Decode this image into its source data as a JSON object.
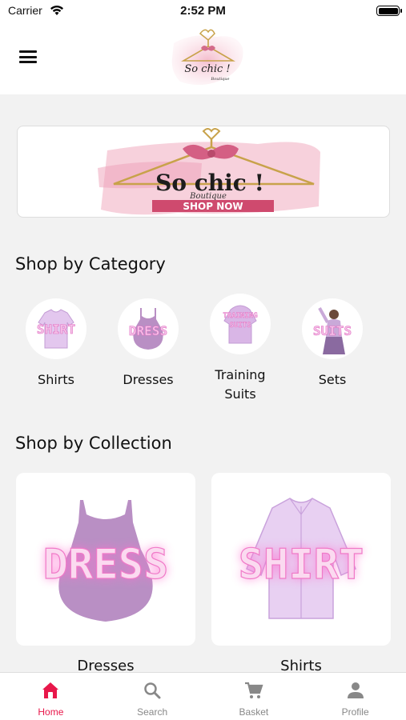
{
  "status_bar": {
    "carrier": "Carrier",
    "time": "2:52 PM"
  },
  "header": {
    "logo_text": "So chic !",
    "logo_subtext": "Boutique"
  },
  "banner": {
    "logo_text": "So chic !",
    "logo_subtext": "Boutique",
    "cta": "SHOP NOW"
  },
  "categories": {
    "title": "Shop by Category",
    "items": [
      {
        "label": "Shirts",
        "image_text": "SHIRT"
      },
      {
        "label": "Dresses",
        "image_text": "DRESS"
      },
      {
        "label": "Training Suits",
        "image_text": "TRAINING SUITS"
      },
      {
        "label": "Sets",
        "image_text": "SUITS"
      }
    ]
  },
  "collections": {
    "title": "Shop by Collection",
    "items": [
      {
        "label": "Dresses",
        "image_text": "DRESS"
      },
      {
        "label": "Shirts",
        "image_text": "SHIRT"
      }
    ]
  },
  "tab_bar": {
    "active": "Home",
    "tabs": [
      {
        "label": "Home",
        "icon": "home-icon"
      },
      {
        "label": "Search",
        "icon": "search-icon"
      },
      {
        "label": "Basket",
        "icon": "cart-icon"
      },
      {
        "label": "Profile",
        "icon": "profile-icon"
      }
    ]
  },
  "colors": {
    "accent": "#e8174a",
    "brand_pink": "#e07da0",
    "product_purple": "#b98fc4",
    "neon_text": "#f9d7ee"
  }
}
